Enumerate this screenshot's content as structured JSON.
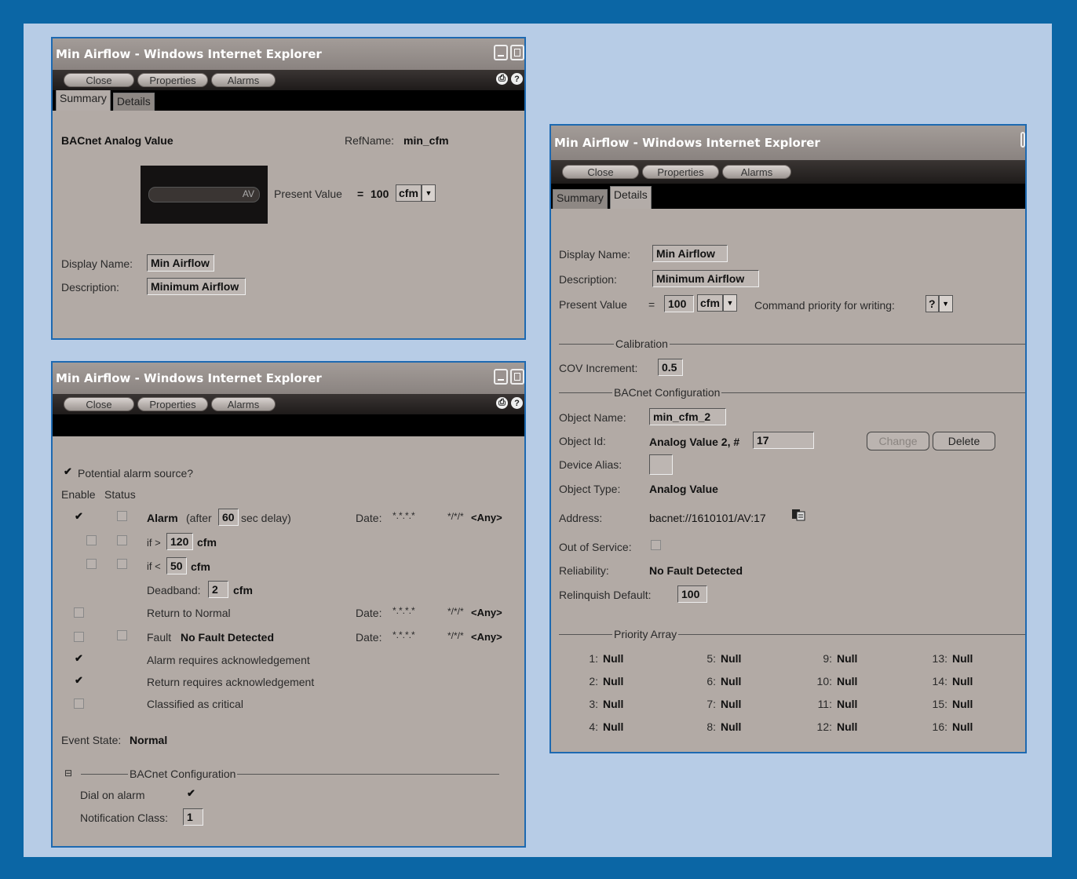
{
  "window_title": "Min Airflow - Windows Internet Explorer",
  "toolbar": {
    "close": "Close",
    "properties": "Properties",
    "alarms": "Alarms"
  },
  "tabs": {
    "summary": "Summary",
    "details": "Details"
  },
  "summary": {
    "object_type": "BACnet Analog Value",
    "refname_label": "RefName:",
    "refname": "min_cfm",
    "gauge_tag": "AV",
    "present_value_label": "Present Value",
    "equals": "=",
    "present_value": "100",
    "unit": "cfm",
    "display_name_label": "Display Name:",
    "display_name": "Min Airflow",
    "description_label": "Description:",
    "description": "Minimum Airflow"
  },
  "alarms": {
    "potential_source": "Potential alarm source?",
    "enable_header": "Enable",
    "status_header": "Status",
    "alarm_label": "Alarm",
    "after_label": "(after",
    "delay": "60",
    "sec_delay": "sec delay)",
    "date_label": "Date:",
    "date_value": "*.*.*.*",
    "time_value": "*/*/*",
    "any": "<Any>",
    "high_label": "if >",
    "high_limit": "120",
    "low_label": "if <",
    "low_limit": "50",
    "unit": "cfm",
    "deadband_label": "Deadband:",
    "deadband": "2",
    "return_normal": "Return to Normal",
    "fault_label": "Fault",
    "fault_value": "No Fault Detected",
    "alarm_ack": "Alarm requires acknowledgement",
    "return_ack": "Return requires acknowledgement",
    "critical": "Classified as critical",
    "event_state_label": "Event State:",
    "event_state": "Normal",
    "collapse": "⊟",
    "bacnet_config": "BACnet Configuration",
    "dial_label": "Dial on alarm",
    "notification_label": "Notification Class:",
    "notification_class": "1"
  },
  "details": {
    "display_name_label": "Display Name:",
    "display_name": "Min Airflow",
    "description_label": "Description:",
    "description": "Minimum Airflow",
    "present_value_label": "Present Value",
    "equals": "=",
    "present_value": "100",
    "unit": "cfm",
    "priority_label": "Command priority for writing:",
    "priority": "?",
    "calibration": "Calibration",
    "cov_label": "COV Increment:",
    "cov": "0.5",
    "bacnet_config": "BACnet Configuration",
    "object_name_label": "Object Name:",
    "object_name": "min_cfm_2",
    "object_id_label": "Object Id:",
    "object_id_prefix": "Analog Value 2, #",
    "object_id": "17",
    "change": "Change",
    "delete": "Delete",
    "device_alias_label": "Device Alias:",
    "object_type_label": "Object Type:",
    "object_type": "Analog Value",
    "address_label": "Address:",
    "address": "bacnet://1610101/AV:17",
    "out_of_service_label": "Out of Service:",
    "reliability_label": "Reliability:",
    "reliability": "No Fault Detected",
    "relinquish_label": "Relinquish Default:",
    "relinquish": "100",
    "priority_array": "Priority Array",
    "priorities": [
      {
        "n": "1:",
        "v": "Null"
      },
      {
        "n": "2:",
        "v": "Null"
      },
      {
        "n": "3:",
        "v": "Null"
      },
      {
        "n": "4:",
        "v": "Null"
      },
      {
        "n": "5:",
        "v": "Null"
      },
      {
        "n": "6:",
        "v": "Null"
      },
      {
        "n": "7:",
        "v": "Null"
      },
      {
        "n": "8:",
        "v": "Null"
      },
      {
        "n": "9:",
        "v": "Null"
      },
      {
        "n": "10:",
        "v": "Null"
      },
      {
        "n": "11:",
        "v": "Null"
      },
      {
        "n": "12:",
        "v": "Null"
      },
      {
        "n": "13:",
        "v": "Null"
      },
      {
        "n": "14:",
        "v": "Null"
      },
      {
        "n": "15:",
        "v": "Null"
      },
      {
        "n": "16:",
        "v": "Null"
      }
    ]
  },
  "icons": {
    "print": "print-icon",
    "help": "help-icon",
    "copy": "copy-icon"
  },
  "colors": {
    "frame": "#0b66a5",
    "background": "#b7cce6",
    "window_border": "#1d69b1",
    "panel": "#b2aaa5"
  }
}
